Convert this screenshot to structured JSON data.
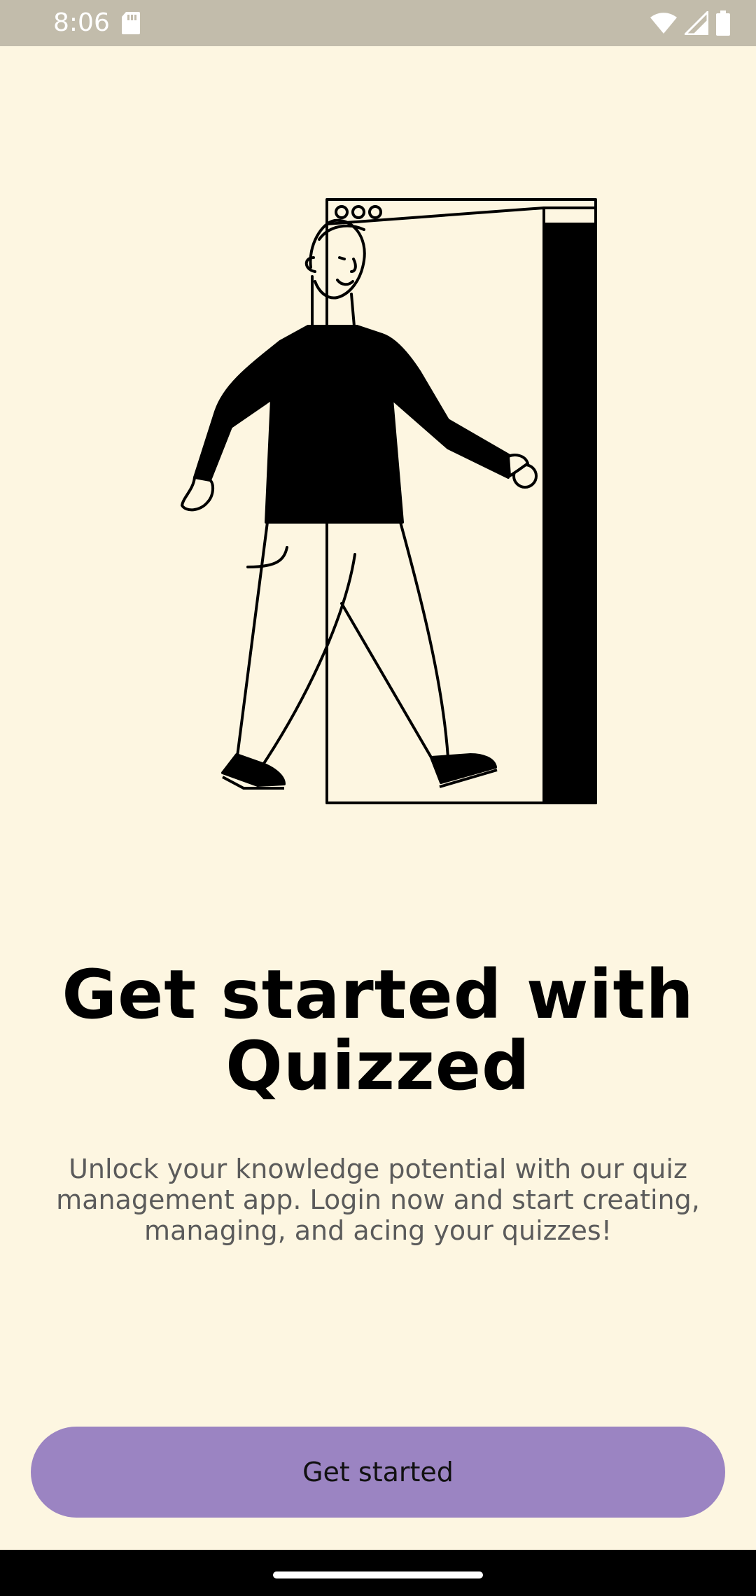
{
  "status_bar": {
    "time": "8:06",
    "icons": [
      "sd-card-icon",
      "wifi-icon",
      "signal-icon",
      "battery-icon"
    ]
  },
  "illustration": {
    "subject": "person-walking-through-door-illustration"
  },
  "onboarding": {
    "headline_line1": "Get started with",
    "headline_line2": "Quizzed",
    "description_line1": "Unlock your knowledge potential with our quiz",
    "description_line2": "management app. Login now and start creating,",
    "description_line3": "managing, and acing your quizzes!",
    "cta_label": "Get started"
  },
  "colors": {
    "background": "#fdf6e1",
    "status_bar": "#c2bcab",
    "cta_background": "#9b84c2",
    "headline": "#000000",
    "description": "#5b5b5b"
  }
}
